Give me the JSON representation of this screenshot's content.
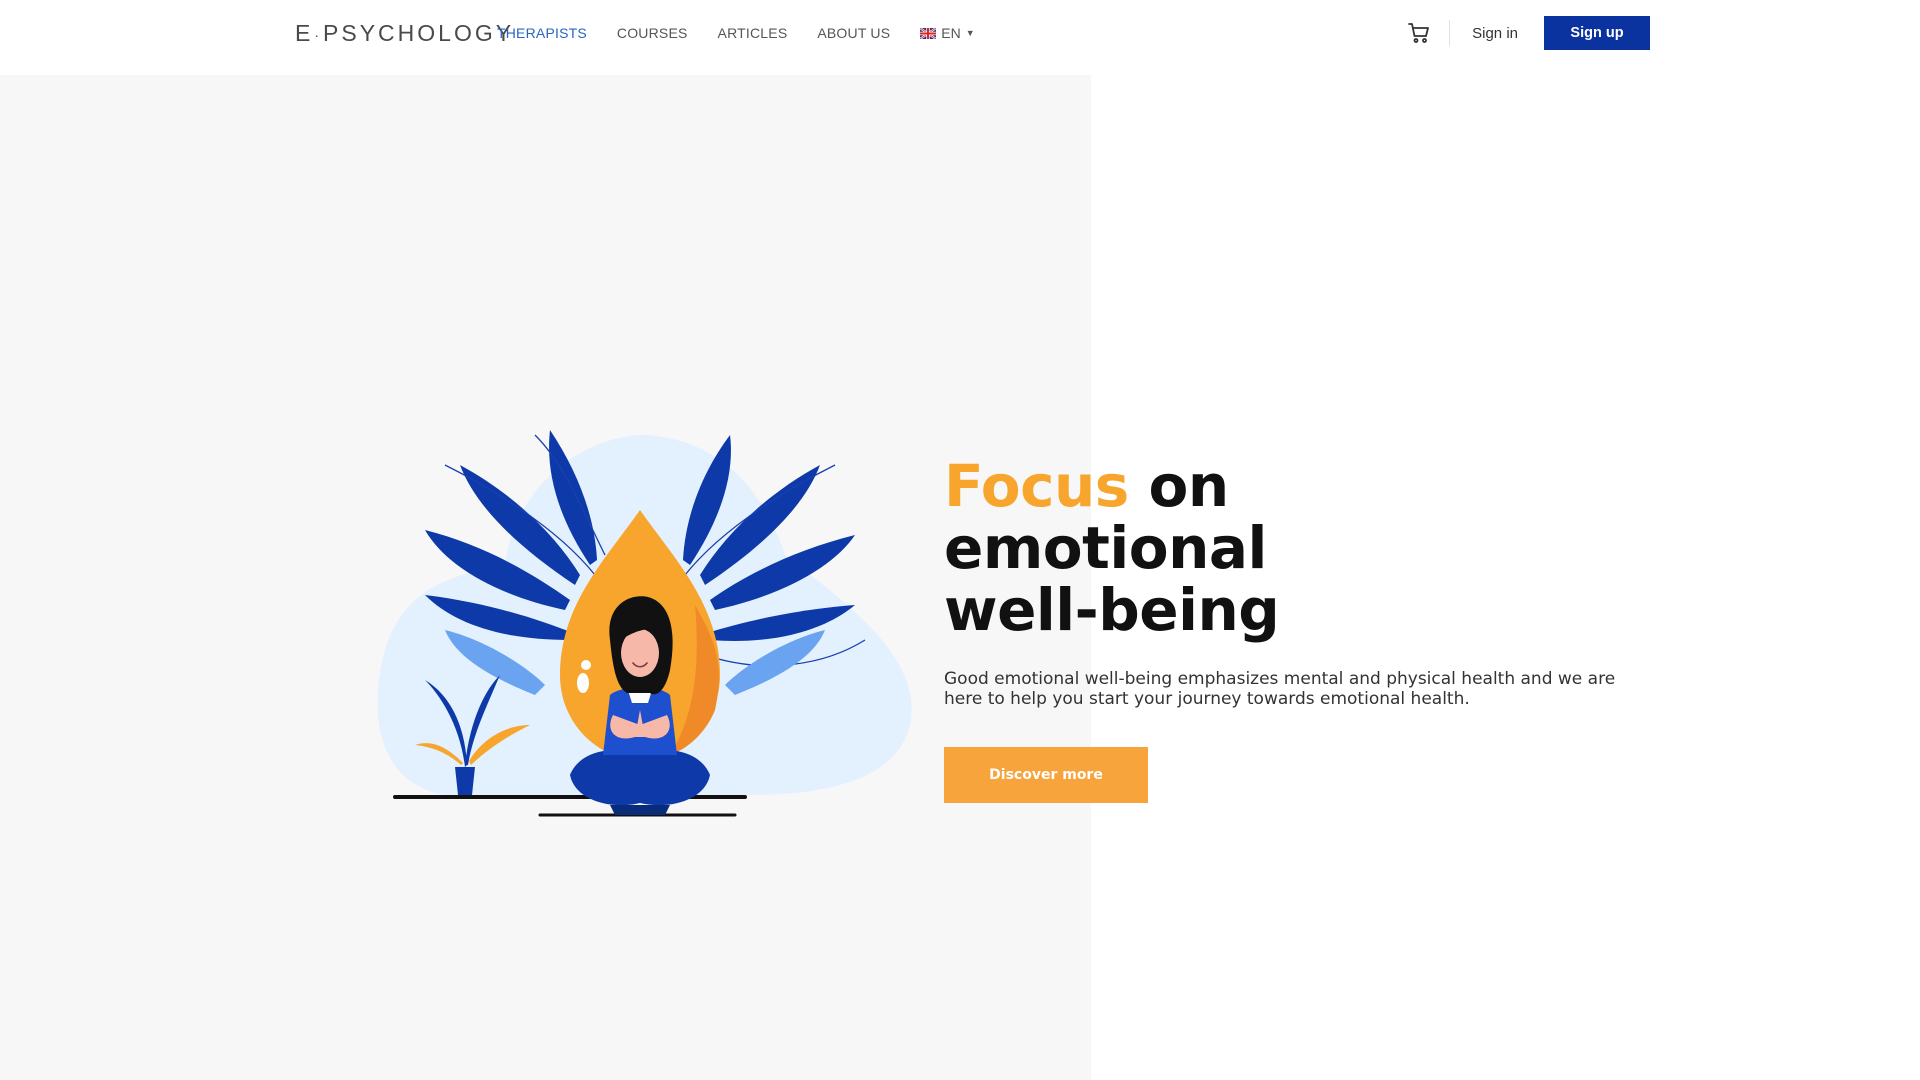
{
  "header": {
    "logo": {
      "prefix": "E",
      "dot": "·",
      "rest": "PSYCHOLOGY"
    },
    "nav": [
      {
        "label": "THERAPISTS",
        "active": true
      },
      {
        "label": "COURSES",
        "active": false
      },
      {
        "label": "ARTICLES",
        "active": false
      },
      {
        "label": "ABOUT US",
        "active": false
      }
    ],
    "language": {
      "code": "EN",
      "flag_icon": "uk-flag-icon"
    },
    "cart_icon": "cart-icon",
    "sign_in": "Sign in",
    "sign_up": "Sign up"
  },
  "hero": {
    "title_accent": "Focus",
    "title_rest_1": " on",
    "title_line_2": "emotional",
    "title_line_3": "well-being",
    "description": "Good emotional well-being emphasizes mental and physical health and we are here to help you start your journey towards emotional health.",
    "cta": "Discover more",
    "illustration": "meditating-woman-illustration"
  },
  "colors": {
    "accent_orange": "#f7a52c",
    "nav_active_blue": "#2a64c4",
    "signup_blue": "#0a33a0",
    "cta_orange": "#f8a43c",
    "left_panel_gray": "#f7f7f7"
  }
}
